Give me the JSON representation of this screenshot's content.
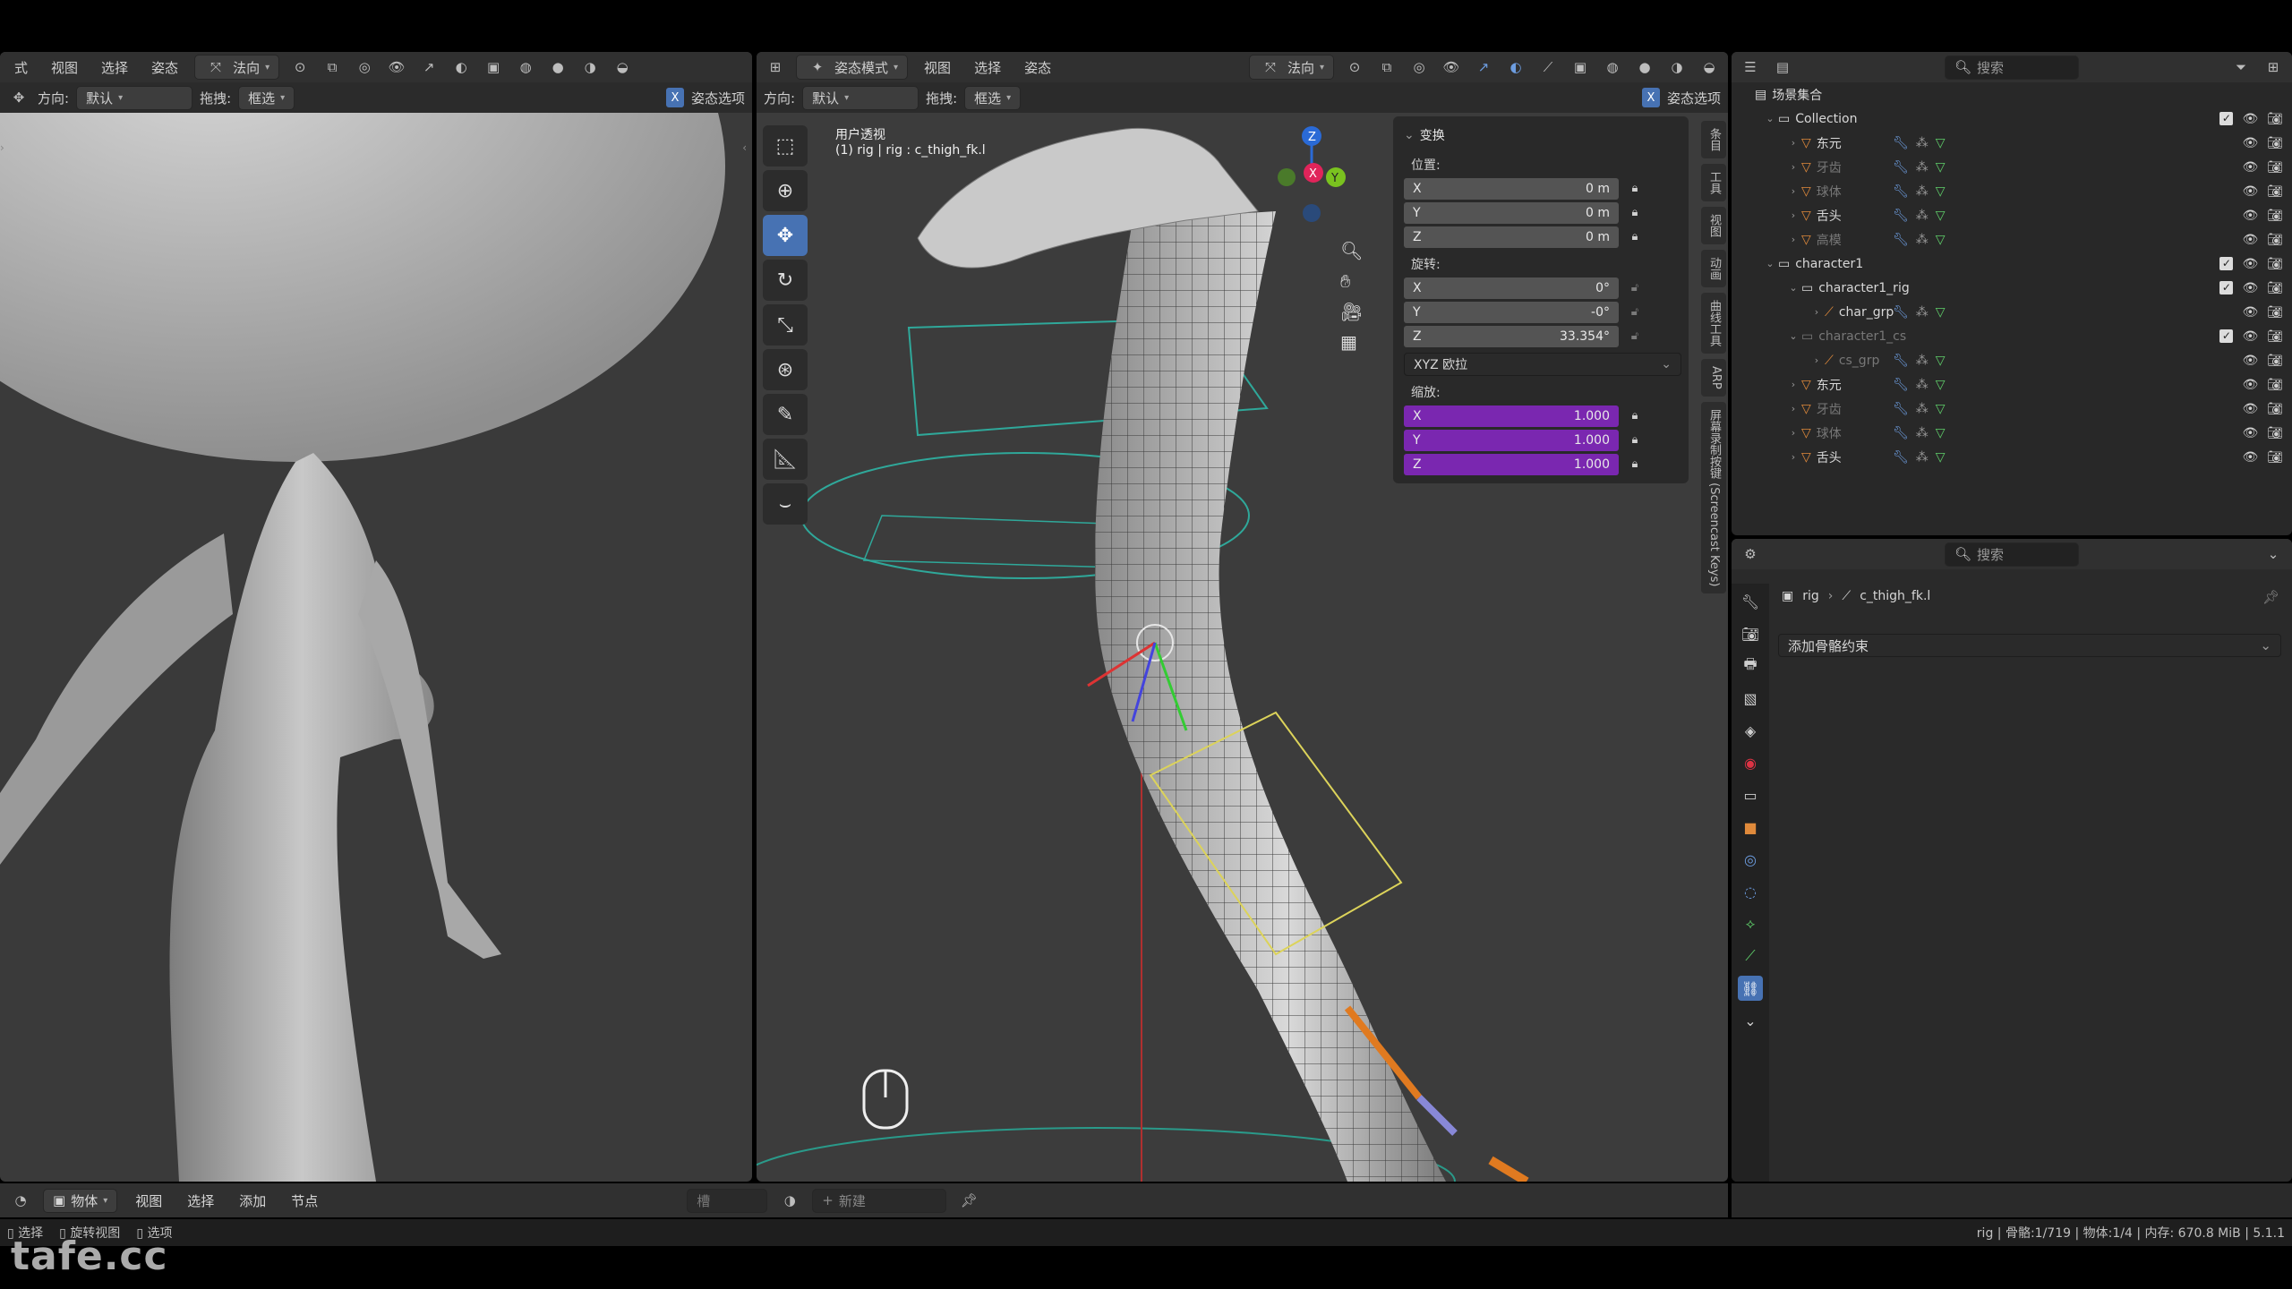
{
  "left_view": {
    "header": {
      "mode_partial": "式",
      "menus": [
        "视图",
        "选择",
        "姿态"
      ],
      "orientation_dd": "法向"
    },
    "header2": {
      "direction_label": "方向:",
      "direction_value": "默认",
      "drag_label": "拖拽:",
      "drag_value": "框选",
      "pose_options": "姿态选项"
    }
  },
  "right_view": {
    "header": {
      "mode": "姿态模式",
      "menus": [
        "视图",
        "选择",
        "姿态"
      ],
      "orientation_dd": "法向"
    },
    "header2": {
      "direction_label": "方向:",
      "direction_value": "默认",
      "drag_label": "拖拽:",
      "drag_value": "框选",
      "pose_options": "姿态选项"
    },
    "overlay": {
      "view_name": "用户透视",
      "active_info": "(1) rig | rig : c_thigh_fk.l"
    },
    "gizmo_axes": {
      "x": "X",
      "y": "Y",
      "z": "Z"
    }
  },
  "npanel": {
    "section": "变换",
    "location_label": "位置:",
    "location": [
      {
        "axis": "X",
        "value": "0 m"
      },
      {
        "axis": "Y",
        "value": "0 m"
      },
      {
        "axis": "Z",
        "value": "0 m"
      }
    ],
    "rotation_label": "旋转:",
    "rotation": [
      {
        "axis": "X",
        "value": "0°"
      },
      {
        "axis": "Y",
        "value": "-0°"
      },
      {
        "axis": "Z",
        "value": "33.354°"
      }
    ],
    "rotation_mode": "XYZ 欧拉",
    "scale_label": "缩放:",
    "scale": [
      {
        "axis": "X",
        "value": "1.000"
      },
      {
        "axis": "Y",
        "value": "1.000"
      },
      {
        "axis": "Z",
        "value": "1.000"
      }
    ]
  },
  "side_tabs": [
    "条目",
    "工具",
    "视图",
    "动画",
    "曲线工具",
    "ARP",
    "屏幕录制按键 (Screencast Keys)"
  ],
  "outliner": {
    "search_placeholder": "搜索",
    "rows": [
      {
        "name": "场景集合",
        "indent": 0,
        "twisty": "",
        "type": "scene"
      },
      {
        "name": "Collection",
        "indent": 1,
        "twisty": "v",
        "type": "collection"
      },
      {
        "name": "东元",
        "indent": 2,
        "twisty": ">",
        "type": "mesh",
        "dim": false
      },
      {
        "name": "牙齿",
        "indent": 2,
        "twisty": ">",
        "type": "mesh",
        "dim": true
      },
      {
        "name": "球体",
        "indent": 2,
        "twisty": ">",
        "type": "mesh",
        "dim": true
      },
      {
        "name": "舌头",
        "indent": 2,
        "twisty": ">",
        "type": "mesh",
        "dim": false
      },
      {
        "name": "高模",
        "indent": 2,
        "twisty": ">",
        "type": "mesh",
        "dim": true
      },
      {
        "name": "character1",
        "indent": 1,
        "twisty": "v",
        "type": "collection"
      },
      {
        "name": "character1_rig",
        "indent": 2,
        "twisty": "v",
        "type": "collection"
      },
      {
        "name": "char_grp",
        "indent": 3,
        "twisty": ">",
        "type": "armature",
        "dim": false
      },
      {
        "name": "character1_cs",
        "indent": 2,
        "twisty": "v",
        "type": "collection",
        "dim": true
      },
      {
        "name": "cs_grp",
        "indent": 3,
        "twisty": ">",
        "type": "armature",
        "dim": true
      },
      {
        "name": "东元",
        "indent": 2,
        "twisty": ">",
        "type": "mesh",
        "dim": false
      },
      {
        "name": "牙齿",
        "indent": 2,
        "twisty": ">",
        "type": "mesh",
        "dim": true
      },
      {
        "name": "球体",
        "indent": 2,
        "twisty": ">",
        "type": "mesh",
        "dim": true
      },
      {
        "name": "舌头",
        "indent": 2,
        "twisty": ">",
        "type": "mesh",
        "dim": false
      }
    ]
  },
  "properties": {
    "search_placeholder": "搜索",
    "breadcrumb": [
      "rig",
      "c_thigh_fk.l"
    ],
    "add_constraint": "添加骨骼约束"
  },
  "bottom_bar": {
    "editor_mode": "物体",
    "menus": [
      "视图",
      "选择",
      "添加",
      "节点"
    ],
    "slot": "槽",
    "new_button": "新建"
  },
  "status_bar": {
    "left": [
      "选择",
      "旋转视图",
      "选项"
    ],
    "right": "rig | 骨骼:1/719 | 物体:1/4 | 内存: 670.8 MiB | 5.1.1"
  },
  "watermark": "tafe.cc",
  "colors": {
    "accent": "#4772b3",
    "scale_field": "#7a27b0",
    "mesh_icon": "#e08a3b",
    "armature_icon": "#e08a3b"
  }
}
